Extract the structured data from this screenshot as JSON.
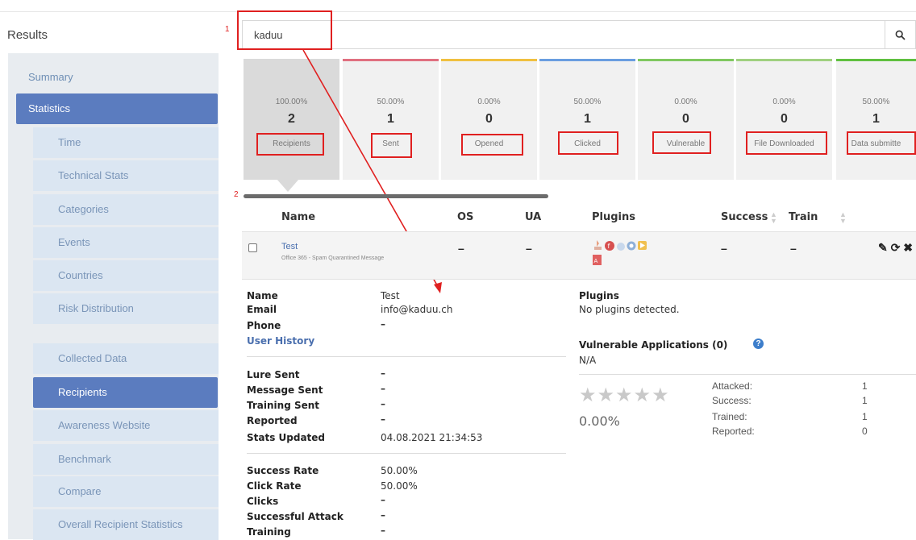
{
  "sidebar": {
    "title": "Results",
    "items": [
      {
        "label": "Summary"
      },
      {
        "label": "Statistics"
      },
      {
        "label": "Time"
      },
      {
        "label": "Technical Stats"
      },
      {
        "label": "Categories"
      },
      {
        "label": "Events"
      },
      {
        "label": "Countries"
      },
      {
        "label": "Risk Distribution"
      },
      {
        "label": "Collected Data"
      },
      {
        "label": "Recipients"
      },
      {
        "label": "Awareness Website"
      },
      {
        "label": "Benchmark"
      },
      {
        "label": "Compare"
      },
      {
        "label": "Overall Recipient Statistics"
      }
    ]
  },
  "search": {
    "value": "kaduu",
    "icon": "search-icon"
  },
  "annotations": {
    "one": "1",
    "two": "2"
  },
  "tiles": [
    {
      "pct": "100.00%",
      "count": "2",
      "label": "Recipients",
      "color": ""
    },
    {
      "pct": "50.00%",
      "count": "1",
      "label": "Sent",
      "color": "#e07080"
    },
    {
      "pct": "0.00%",
      "count": "0",
      "label": "Opened",
      "color": "#f0c040"
    },
    {
      "pct": "50.00%",
      "count": "1",
      "label": "Clicked",
      "color": "#6a9ee0"
    },
    {
      "pct": "0.00%",
      "count": "0",
      "label": "Vulnerable",
      "color": "#80c860"
    },
    {
      "pct": "0.00%",
      "count": "0",
      "label": "File Downloaded",
      "color": "#a0d080"
    },
    {
      "pct": "50.00%",
      "count": "1",
      "label": "Data submitte",
      "color": "#60c040"
    }
  ],
  "table": {
    "headers": {
      "name": "Name",
      "os": "OS",
      "ua": "UA",
      "plugins": "Plugins",
      "success": "Success",
      "train": "Train"
    },
    "row": {
      "name": "Test",
      "subtitle": "Office 365 - Spam Quarantined Message",
      "os": "–",
      "ua": "–",
      "success": "–",
      "train": "–"
    }
  },
  "details": {
    "name_label": "Name",
    "name_value": "Test",
    "email_label": "Email",
    "email_value": "info@kaduu.ch",
    "phone_label": "Phone",
    "phone_value": "–",
    "user_history": "User History",
    "lure_sent_label": "Lure Sent",
    "lure_sent_value": "–",
    "message_sent_label": "Message Sent",
    "message_sent_value": "–",
    "training_sent_label": "Training Sent",
    "training_sent_value": "–",
    "reported_label": "Reported",
    "reported_value": "–",
    "stats_updated_label": "Stats Updated",
    "stats_updated_value": "04.08.2021 21:34:53",
    "success_rate_label": "Success Rate",
    "success_rate_value": "50.00%",
    "click_rate_label": "Click Rate",
    "click_rate_value": "50.00%",
    "clicks_label": "Clicks",
    "clicks_value": "–",
    "successful_attack_label": "Successful Attack",
    "successful_attack_value": "–",
    "training_label": "Training",
    "training_value": "–"
  },
  "plugins_panel": {
    "title": "Plugins",
    "text": "No plugins detected.",
    "vuln_title": "Vulnerable Applications (0)",
    "vuln_value": "N/A",
    "stars": "★★★★★",
    "rating_pct": "0.00%",
    "attacked_label": "Attacked:",
    "attacked_value": "1",
    "success_label": "Success:",
    "success_value": "1",
    "trained_label": "Trained:",
    "trained_value": "1",
    "reported_label": "Reported:",
    "reported_value": "0"
  }
}
